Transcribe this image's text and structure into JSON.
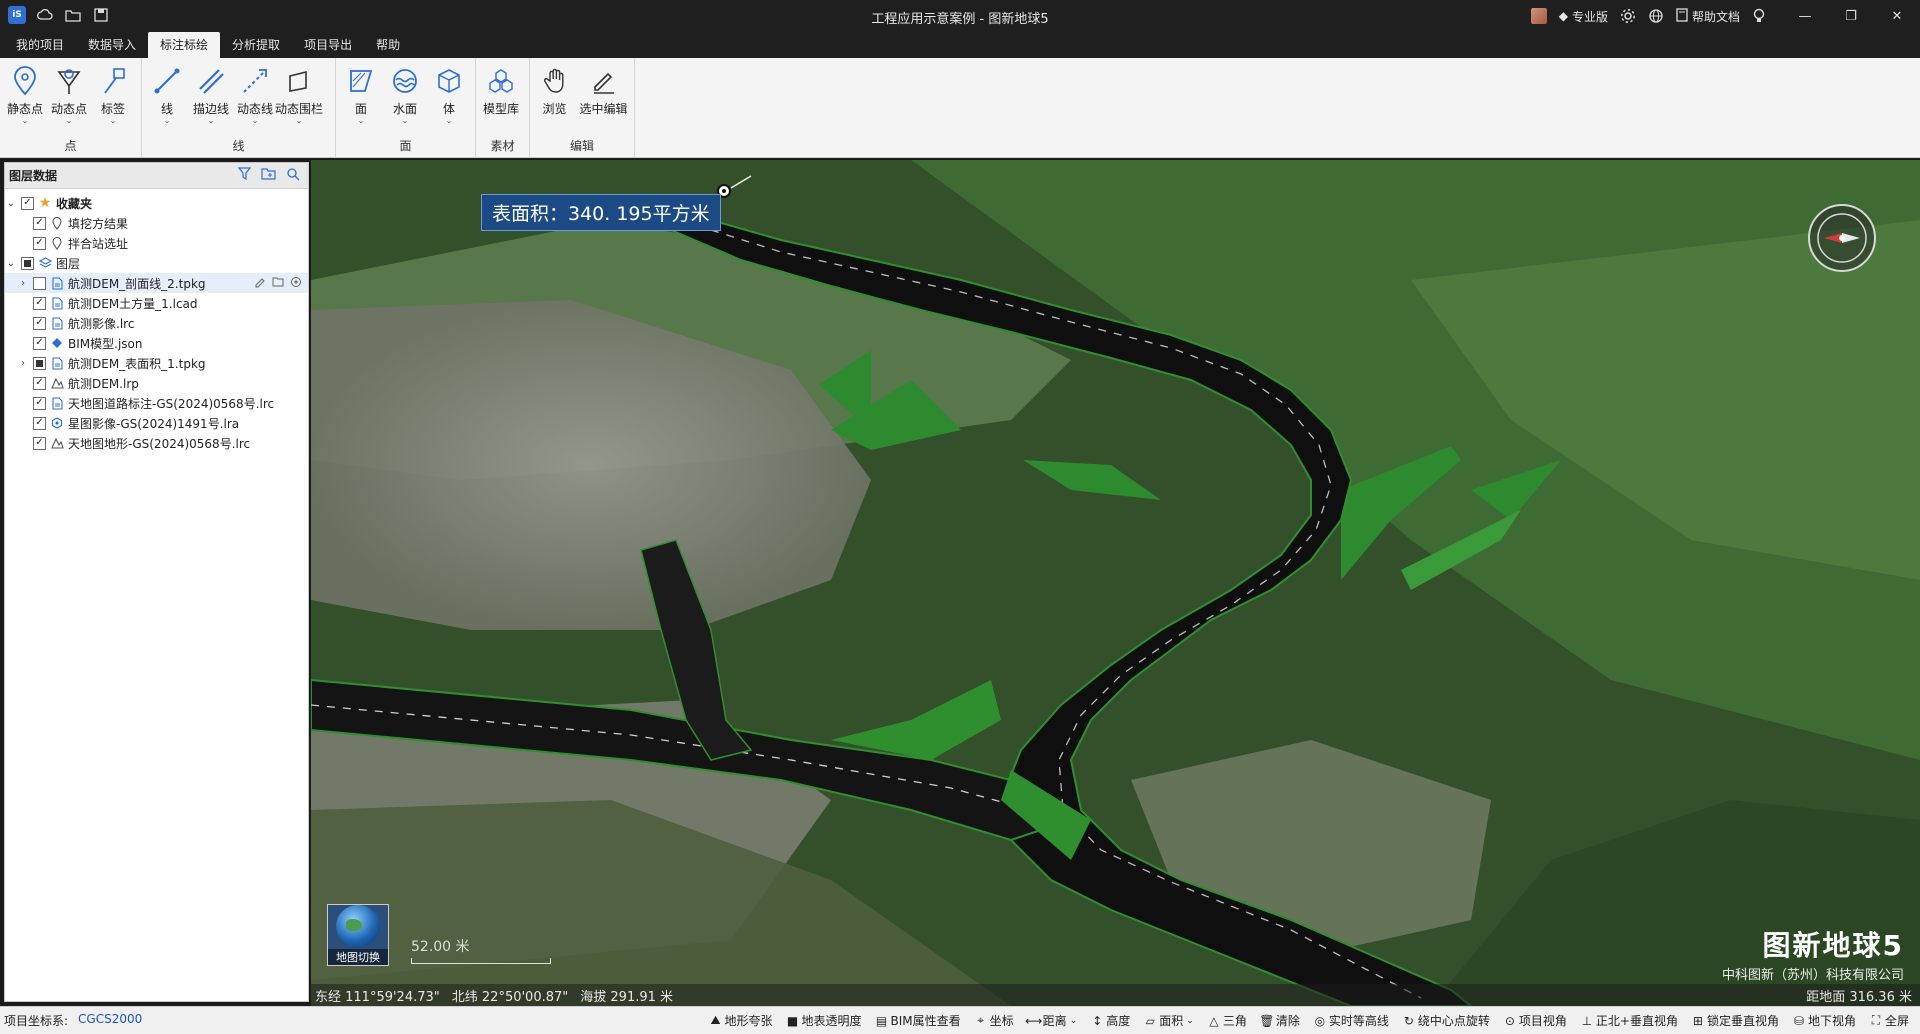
{
  "window": {
    "title": "工程应用示意案例 - 图新地球5",
    "edition": "专业版",
    "help_doc": "帮助文档",
    "app_logo": "iS"
  },
  "menu": {
    "tabs": [
      {
        "label": "我的项目"
      },
      {
        "label": "数据导入"
      },
      {
        "label": "标注标绘"
      },
      {
        "label": "分析提取"
      },
      {
        "label": "项目导出"
      },
      {
        "label": "帮助"
      }
    ]
  },
  "ribbon": {
    "groups": [
      {
        "label": "点",
        "buttons": [
          {
            "label": "静态点"
          },
          {
            "label": "动态点"
          },
          {
            "label": "标签"
          }
        ]
      },
      {
        "label": "线",
        "buttons": [
          {
            "label": "线"
          },
          {
            "label": "描边线"
          },
          {
            "label": "动态线"
          },
          {
            "label": "动态围栏"
          }
        ]
      },
      {
        "label": "面",
        "buttons": [
          {
            "label": "面"
          },
          {
            "label": "水面"
          },
          {
            "label": "体"
          }
        ]
      },
      {
        "label": "素材",
        "buttons": [
          {
            "label": "模型库"
          }
        ]
      },
      {
        "label": "编辑",
        "buttons": [
          {
            "label": "浏览"
          },
          {
            "label": "选中编辑"
          }
        ]
      }
    ]
  },
  "layer_panel": {
    "title": "图层数据",
    "favorites": {
      "label": "收藏夹",
      "items": [
        {
          "label": "填挖方结果"
        },
        {
          "label": "拌合站选址"
        }
      ]
    },
    "layers": {
      "label": "图层",
      "items": [
        {
          "label": "航测DEM_剖面线_2.tpkg",
          "checked": "no",
          "expandable": "yes"
        },
        {
          "label": "航测DEM土方量_1.lcad",
          "checked": "yes"
        },
        {
          "label": "航测影像.lrc",
          "checked": "yes"
        },
        {
          "label": "BIM模型.json",
          "checked": "yes"
        },
        {
          "label": "航测DEM_表面积_1.tpkg",
          "checked": "partial",
          "expandable": "yes"
        },
        {
          "label": "航测DEM.lrp",
          "checked": "yes"
        },
        {
          "label": "天地图道路标注-GS(2024)0568号.lrc",
          "checked": "yes"
        },
        {
          "label": "星图影像-GS(2024)1491号.lra",
          "checked": "yes"
        },
        {
          "label": "天地图地形-GS(2024)0568号.lrc",
          "checked": "yes"
        }
      ]
    }
  },
  "viewport": {
    "measure_label": "表面积：340. 195平方米",
    "map_switch": "地图切换",
    "scale_label": "52.00 米",
    "brand_title": "图新地球5",
    "brand_company": "中科图新（苏州）科技有限公司",
    "longitude": "东经 111°59'24.73\"",
    "latitude": "北纬 22°50'00.87\"",
    "altitude": "海拔 291.91 米",
    "distance": "距地面 316.36 米"
  },
  "statusbar": {
    "crs_label": "项目坐标系:",
    "crs_value": "CGCS2000",
    "tools": [
      {
        "label": "地形夸张",
        "icon": "terrain-icon"
      },
      {
        "label": "地表透明度",
        "icon": "opacity-icon"
      },
      {
        "label": "BIM属性查看",
        "icon": "bim-icon"
      },
      {
        "label": "坐标",
        "icon": "coordinate-icon"
      },
      {
        "label": "距离",
        "icon": "distance-icon"
      },
      {
        "label": "高度",
        "icon": "height-icon"
      },
      {
        "label": "面积",
        "icon": "area-icon"
      },
      {
        "label": "三角",
        "icon": "triangle-icon"
      },
      {
        "label": "清除",
        "icon": "trash-icon"
      },
      {
        "label": "实时等高线",
        "icon": "contour-icon"
      },
      {
        "label": "绕中心点旋转",
        "icon": "rotate-icon"
      },
      {
        "label": "项目视角",
        "icon": "view-icon"
      },
      {
        "label": "正北+垂直视角",
        "icon": "north-icon"
      },
      {
        "label": "锁定垂直视角",
        "icon": "lock-icon"
      },
      {
        "label": "地下视角",
        "icon": "underground-icon"
      },
      {
        "label": "全屏",
        "icon": "fullscreen-icon"
      }
    ]
  },
  "colors": {
    "accent": "#1c4a85",
    "road": "#111111",
    "vegetation": "#2f5a2a",
    "ribbon_icon": "#2c6fd1"
  }
}
